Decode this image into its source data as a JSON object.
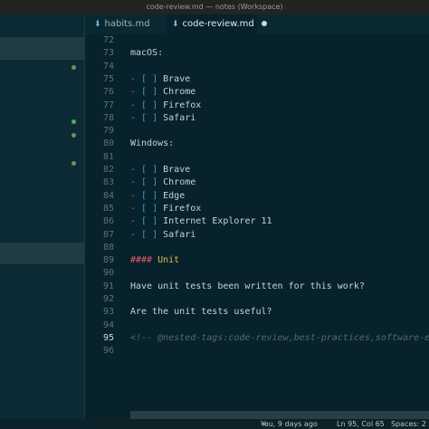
{
  "window": {
    "title": "code-review.md — notes (Workspace)"
  },
  "tabs": [
    {
      "label": "habits.md",
      "active": false
    },
    {
      "label": "code-review.md",
      "active": true,
      "modified": true
    }
  ],
  "editor": {
    "active_line": "95",
    "lines": [
      {
        "n": "72"
      },
      {
        "n": "73",
        "text": "macOS:"
      },
      {
        "n": "74"
      },
      {
        "n": "75",
        "dash": "- [ ]",
        "text": " Brave"
      },
      {
        "n": "76",
        "dash": "- [ ]",
        "text": " Chrome"
      },
      {
        "n": "77",
        "dash": "- [ ]",
        "text": " Firefox"
      },
      {
        "n": "78",
        "dash": "- [ ]",
        "text": " Safari"
      },
      {
        "n": "79"
      },
      {
        "n": "80",
        "text": "Windows:"
      },
      {
        "n": "81"
      },
      {
        "n": "82",
        "dash": "- [ ]",
        "text": " Brave"
      },
      {
        "n": "83",
        "dash": "- [ ]",
        "text": " Chrome"
      },
      {
        "n": "84",
        "dash": "- [ ]",
        "text": " Edge"
      },
      {
        "n": "85",
        "dash": "- [ ]",
        "text": " Firefox"
      },
      {
        "n": "86",
        "dash": "- [ ]",
        "text": " Internet Explorer 11"
      },
      {
        "n": "87",
        "dash": "- [ ]",
        "text": " Safari"
      },
      {
        "n": "88"
      },
      {
        "n": "89",
        "hash": "####",
        "utitle": " Unit"
      },
      {
        "n": "90"
      },
      {
        "n": "91",
        "text": "Have unit tests been written for this work?"
      },
      {
        "n": "92"
      },
      {
        "n": "93",
        "text": "Are the unit tests useful?"
      },
      {
        "n": "94"
      },
      {
        "n": "95",
        "comment": "<!-- @nested-tags:code-review,best-practices,software-engin"
      },
      {
        "n": "96"
      }
    ]
  },
  "status": {
    "blame": "You, 9 days ago",
    "position": "Ln 95, Col 65",
    "spaces": "Spaces: 2"
  },
  "colors": {
    "background": "#07222a",
    "checkbox_dash": "#3d97c8",
    "heading_hash": "#e8576c",
    "heading_text": "#e0b84f",
    "comment": "#54696f",
    "gutter_dot": "#7c8a5a",
    "gutter_dot_added": "#4caf50"
  }
}
